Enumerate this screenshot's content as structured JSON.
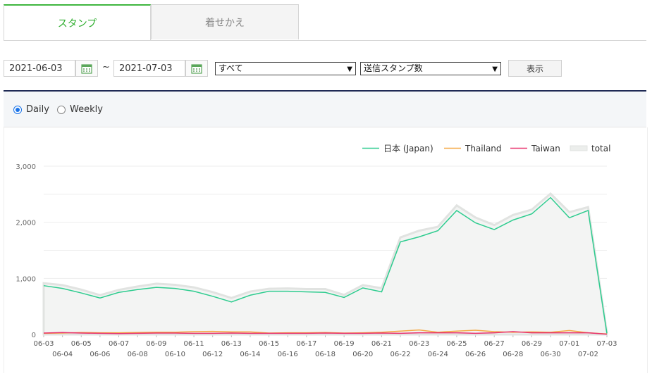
{
  "tabs": [
    {
      "label": "スタンプ",
      "active": true
    },
    {
      "label": "着せかえ",
      "active": false
    }
  ],
  "filters": {
    "start_date": "2021-06-03",
    "separator": "~",
    "end_date": "2021-07-03",
    "region_select": "すべて",
    "metric_select": "送信スタンプ数",
    "show_button": "表示"
  },
  "granularity": {
    "options": [
      "Daily",
      "Weekly"
    ],
    "selected": "Daily"
  },
  "colors": {
    "accent": "#2fae2f",
    "japan": "#2ecc8f",
    "thailand": "#f5a742",
    "taiwan": "#e8336e",
    "total": "#e3e5e3"
  },
  "chart_data": {
    "type": "line",
    "legend_position": "top-right",
    "grid": true,
    "ylim": [
      0,
      3000
    ],
    "yticks": [
      "0",
      "1,000",
      "2,000",
      "3,000"
    ],
    "x": [
      "06-03",
      "06-04",
      "06-05",
      "06-06",
      "06-07",
      "06-08",
      "06-09",
      "06-10",
      "06-11",
      "06-12",
      "06-13",
      "06-14",
      "06-15",
      "06-16",
      "06-17",
      "06-18",
      "06-19",
      "06-20",
      "06-21",
      "06-22",
      "06-23",
      "06-24",
      "06-25",
      "06-26",
      "06-27",
      "06-28",
      "06-29",
      "06-30",
      "07-01",
      "07-02",
      "07-03"
    ],
    "series": [
      {
        "name": "日本 (Japan)",
        "key": "japan",
        "values": [
          870,
          820,
          740,
          650,
          750,
          800,
          840,
          820,
          770,
          680,
          580,
          700,
          770,
          770,
          760,
          750,
          660,
          830,
          760,
          1650,
          1740,
          1850,
          2210,
          1990,
          1870,
          2040,
          2150,
          2440,
          2080,
          2210,
          20
        ]
      },
      {
        "name": "Thailand",
        "key": "thailand",
        "values": [
          20,
          25,
          35,
          30,
          30,
          35,
          40,
          40,
          50,
          55,
          45,
          45,
          25,
          30,
          30,
          35,
          25,
          30,
          40,
          60,
          80,
          40,
          60,
          75,
          50,
          40,
          45,
          40,
          70,
          30,
          10
        ]
      },
      {
        "name": "Taiwan",
        "key": "taiwan",
        "values": [
          25,
          35,
          25,
          20,
          15,
          20,
          25,
          25,
          20,
          20,
          25,
          20,
          20,
          20,
          20,
          25,
          20,
          20,
          25,
          20,
          30,
          30,
          30,
          20,
          30,
          50,
          30,
          30,
          30,
          30,
          5
        ]
      },
      {
        "name": "total",
        "key": "total",
        "values": [
          915,
          880,
          800,
          700,
          795,
          855,
          905,
          885,
          840,
          755,
          650,
          765,
          815,
          820,
          810,
          810,
          705,
          880,
          825,
          1730,
          1850,
          1920,
          2300,
          2085,
          1950,
          2130,
          2225,
          2510,
          2180,
          2270,
          35
        ]
      }
    ]
  }
}
